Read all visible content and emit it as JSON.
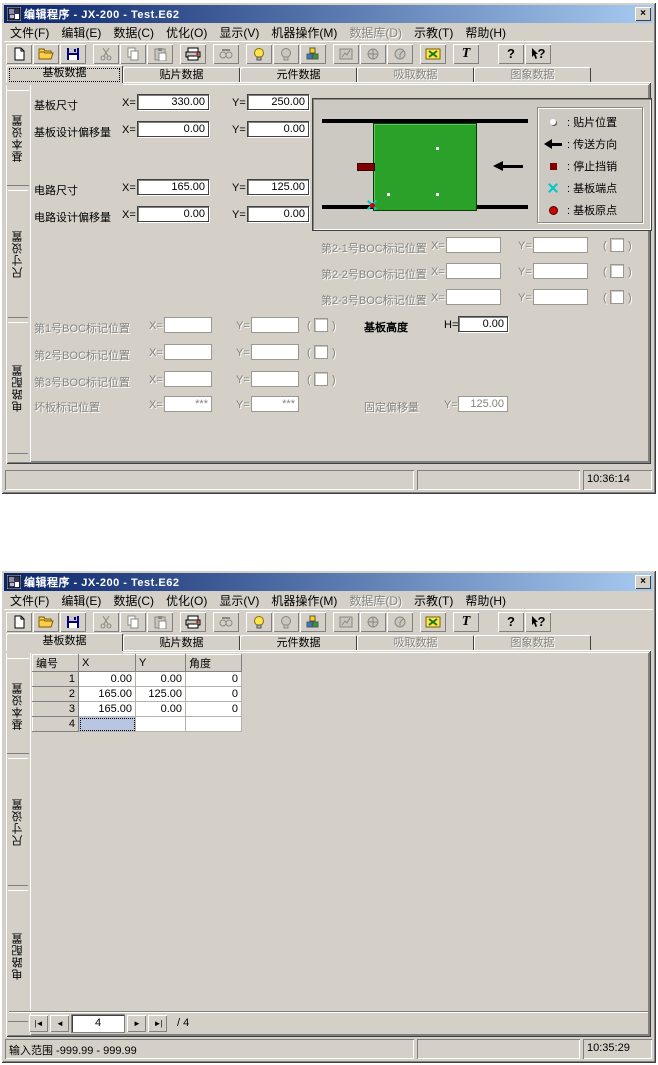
{
  "app": {
    "title": "编辑程序 - JX-200 - Test.E62",
    "close_glyph": "×"
  },
  "menu": {
    "items": [
      {
        "label": "文件(F)",
        "enabled": true
      },
      {
        "label": "编辑(E)",
        "enabled": true
      },
      {
        "label": "数据(C)",
        "enabled": true
      },
      {
        "label": "优化(O)",
        "enabled": true
      },
      {
        "label": "显示(V)",
        "enabled": true
      },
      {
        "label": "机器操作(M)",
        "enabled": true
      },
      {
        "label": "数据库(D)",
        "enabled": false
      },
      {
        "label": "示教(T)",
        "enabled": true
      },
      {
        "label": "帮助(H)",
        "enabled": true
      }
    ]
  },
  "toolbar": {
    "buttons": [
      {
        "name": "new-file",
        "enabled": true
      },
      {
        "name": "open-file",
        "enabled": true
      },
      {
        "name": "save-file",
        "enabled": true
      },
      {
        "name": "cut",
        "enabled": false
      },
      {
        "name": "copy",
        "enabled": false
      },
      {
        "name": "paste",
        "enabled": false
      },
      {
        "name": "print",
        "enabled": true
      },
      {
        "name": "find",
        "enabled": false
      },
      {
        "name": "optimize-on",
        "enabled": true
      },
      {
        "name": "optimize-off",
        "enabled": false
      },
      {
        "name": "component-blocks",
        "enabled": true
      },
      {
        "name": "machine-a",
        "enabled": false
      },
      {
        "name": "machine-b",
        "enabled": false
      },
      {
        "name": "machine-c",
        "enabled": false
      },
      {
        "name": "board-view",
        "enabled": true
      },
      {
        "name": "text-tool",
        "enabled": true,
        "glyph": "T"
      },
      {
        "name": "help",
        "enabled": true,
        "glyph": "?"
      },
      {
        "name": "context-help",
        "enabled": true,
        "glyph": "?"
      }
    ]
  },
  "tabs": {
    "items": [
      {
        "label": "基板数据",
        "enabled": true,
        "active": true
      },
      {
        "label": "贴片数据",
        "enabled": true
      },
      {
        "label": "元件数据",
        "enabled": true
      },
      {
        "label": "吸取数据",
        "enabled": false
      },
      {
        "label": "图象数据",
        "enabled": false
      }
    ]
  },
  "side_tabs": {
    "items": [
      {
        "label": "基本设置",
        "active": true
      },
      {
        "label": "尺寸设置"
      },
      {
        "label": "电路配置"
      }
    ]
  },
  "labels": {
    "x_eq": "X=",
    "y_eq": "Y=",
    "h_eq": "H=",
    "paren_l": "(",
    "paren_r": ")"
  },
  "win1": {
    "board_size_label": "基板尺寸",
    "board_size_x": "330.00",
    "board_size_y": "250.00",
    "board_offset_label": "基板设计偏移量",
    "board_offset_x": "0.00",
    "board_offset_y": "0.00",
    "circuit_size_label": "电路尺寸",
    "circuit_size_x": "165.00",
    "circuit_size_y": "125.00",
    "circuit_offset_label": "电路设计偏移量",
    "circuit_offset_x": "0.00",
    "circuit_offset_y": "0.00",
    "boc21_label": "第2-1号BOC标记位置",
    "boc22_label": "第2-2号BOC标记位置",
    "boc23_label": "第2-3号BOC标记位置",
    "boc1_label": "第1号BOC标记位置",
    "boc2_label": "第2号BOC标记位置",
    "boc3_label": "第3号BOC标记位置",
    "bad_label": "坏板标记位置",
    "bad_x": "***",
    "bad_y": "***",
    "height_label": "基板高度",
    "height_value": "0.00",
    "fixed_label": "固定偏移量",
    "fixed_value": "125.00",
    "legend": [
      {
        "icon": "placement-dot",
        "label": ": 贴片位置"
      },
      {
        "icon": "transfer-arrow",
        "label": ": 传送方向"
      },
      {
        "icon": "stop-pin",
        "label": ": 停止挡销"
      },
      {
        "icon": "board-endpoint",
        "label": ": 基板端点"
      },
      {
        "icon": "board-origin",
        "label": ": 基板原点"
      }
    ],
    "status_time": "10:36:14"
  },
  "win2": {
    "table": {
      "headers": [
        "编号",
        "X",
        "Y",
        "角度"
      ],
      "rows": [
        [
          "1",
          "0.00",
          "0.00",
          "0"
        ],
        [
          "2",
          "165.00",
          "125.00",
          "0"
        ],
        [
          "3",
          "165.00",
          "0.00",
          "0"
        ]
      ],
      "next_row": "4"
    },
    "nav": {
      "first": "|◄",
      "prev": "◄",
      "value": "4",
      "next": "►",
      "last": "►|",
      "total": "/ 4"
    },
    "status_left": "输入范围  -999.99 - 999.99",
    "status_time": "10:35:29"
  },
  "colors": {
    "titlebar_start": "#0a246a",
    "titlebar_end": "#a6caf0",
    "window_bg": "#d4d0c8",
    "board_green": "#2aa22a",
    "stop_pin": "#7f0000",
    "endpoint_cyan": "#00c8c8",
    "origin_red": "#d00000",
    "selected_cell": "#b8c6e2"
  }
}
